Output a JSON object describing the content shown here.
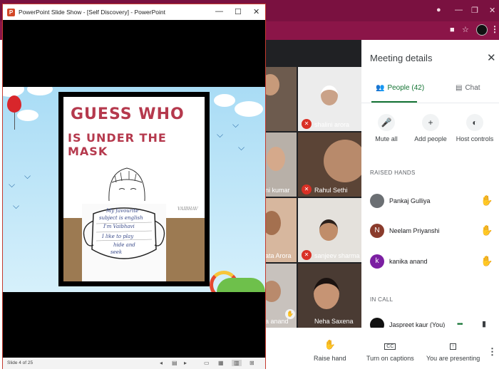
{
  "powerpoint": {
    "title": "PowerPoint Slide Show - [Self Discovery] - PowerPoint",
    "minimize": "—",
    "maximize": "☐",
    "close": "✕",
    "status": {
      "slide_indicator": "Slide 4 of 25"
    },
    "slide": {
      "heading_line1": "GUESS WHO",
      "heading_line2": "IS UNDER THE MASK",
      "handwriting": [
        "My favourite",
        "subject is english",
        "I'm Vaibhavi",
        "I like to play",
        "hide and",
        "seek"
      ],
      "initials": "VAIBHAV"
    }
  },
  "chrome": {
    "icons": [
      "location-icon",
      "star-icon",
      "video-icon"
    ]
  },
  "meet": {
    "tiles": [
      {
        "name": "",
        "muted": false
      },
      {
        "name": "shalini arora",
        "muted": true
      },
      {
        "name": "ni kumar",
        "muted": false
      },
      {
        "name": "Rahul Sethi",
        "muted": true
      },
      {
        "name": "ata Arora",
        "muted": false
      },
      {
        "name": "sanjeev sharma",
        "muted": true
      },
      {
        "name": "a anand",
        "muted": false
      },
      {
        "name": "Neha Saxena",
        "muted": false
      }
    ],
    "panel": {
      "title": "Meeting details",
      "tabs": {
        "people": "People (42)",
        "chat": "Chat"
      },
      "actions": {
        "mute_all": "Mute all",
        "add_people": "Add people",
        "host_controls": "Host controls"
      },
      "raised_hands_label": "RAISED HANDS",
      "raised_hands": [
        {
          "name": "Pankaj Gulliya",
          "initial": "",
          "color": "#6b6f73"
        },
        {
          "name": "Neelam Priyanshi",
          "initial": "N",
          "color": "#8a3b2c"
        },
        {
          "name": "kanika anand",
          "initial": "k",
          "color": "#7b1fa2"
        }
      ],
      "in_call_label": "IN CALL",
      "in_call": [
        {
          "name": "Jaspreet kaur (You)",
          "color": "#111111"
        }
      ]
    },
    "toolbar": {
      "raise_hand": "Raise hand",
      "captions": "Turn on captions",
      "presenting": "You are presenting"
    }
  }
}
